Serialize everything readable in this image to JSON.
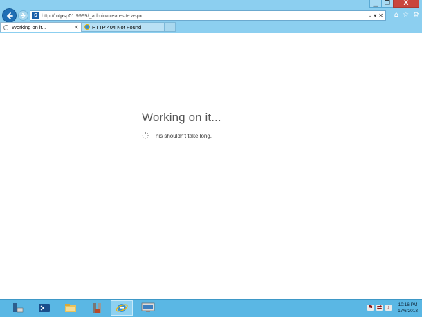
{
  "browser": {
    "url_prefix": "http://",
    "url_host": "mtpsp01",
    "url_rest": ":9999/_admin/createsite.aspx",
    "site_icon_label": "S",
    "address_search_glyph": "⌕",
    "address_dropdown_glyph": "▾",
    "address_refresh_glyph": "✕",
    "tool_icons": [
      "home-icon",
      "star-icon",
      "gear-icon"
    ]
  },
  "window_controls": {
    "minimize": "▁",
    "maximize": "❐",
    "close": "X"
  },
  "tabs": [
    {
      "label": "Working on it...",
      "active": true,
      "close": "✕"
    },
    {
      "label": "HTTP 404 Not Found",
      "active": false
    }
  ],
  "page": {
    "title": "Working on it...",
    "message": "This shouldn't take long."
  },
  "taskbar": {
    "apps": [
      "server-manager-icon",
      "powershell-icon",
      "file-explorer-icon",
      "sharepoint-admin-icon",
      "internet-explorer-icon",
      "remote-desktop-icon"
    ],
    "active_app_index": 4,
    "tray_icons": [
      "action-center-icon",
      "network-icon",
      "volume-icon"
    ],
    "time": "10:16 PM",
    "date": "17/6/2013"
  },
  "colors": {
    "chrome": "#8ccff0",
    "taskbar": "#5ab7e4",
    "close_button": "#c9463d",
    "back_button": "#1f6fb5"
  }
}
